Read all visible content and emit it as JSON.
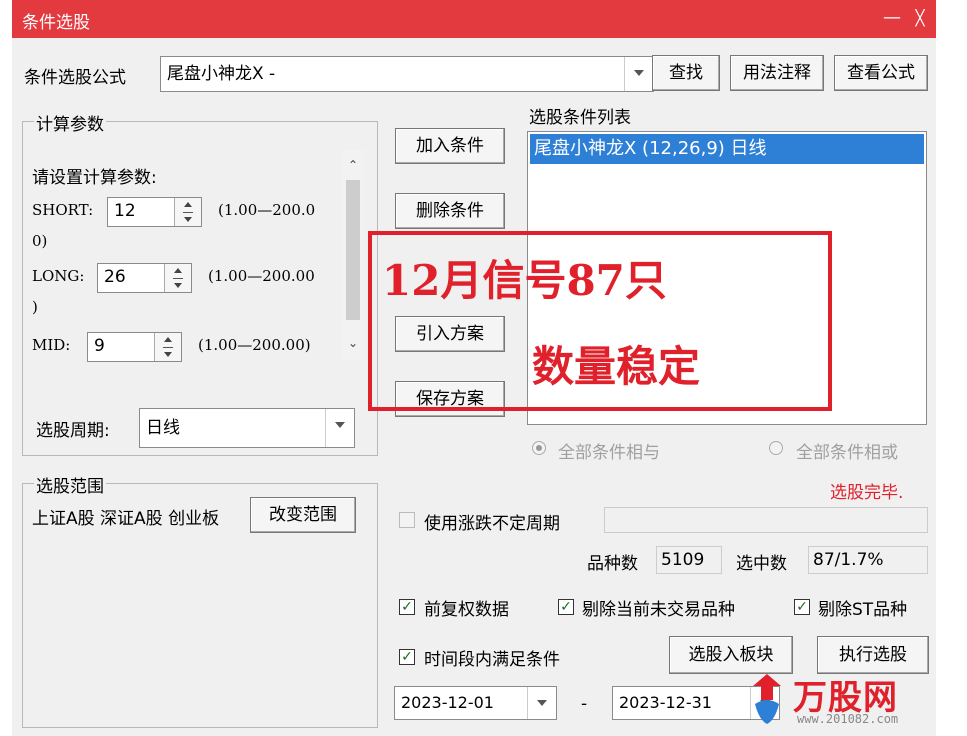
{
  "window": {
    "title": "条件选股",
    "minimize_symbol": "—",
    "close_symbol": "╳"
  },
  "formula": {
    "label": "条件选股公式",
    "value": "尾盘小神龙X  -",
    "find_button": "查找",
    "usage_button": "用法注释",
    "view_button": "查看公式"
  },
  "params": {
    "group_title": "计算参数",
    "prompt": "请设置计算参数:",
    "rows": [
      {
        "name": "SHORT:",
        "value": "12",
        "range": "(1.00—200.0",
        "range_cont": "0)"
      },
      {
        "name": "LONG:",
        "value": "26",
        "range": "(1.00—200.00",
        "range_cont": ")"
      },
      {
        "name": "MID:",
        "value": "9",
        "range": "(1.00—200.00)"
      }
    ],
    "period_label": "选股周期:",
    "period_value": "日线"
  },
  "scope": {
    "group_title": "选股范围",
    "text": "上证A股 深证A股 创业板",
    "change_button": "改变范围"
  },
  "actions": {
    "add": "加入条件",
    "delete": "删除条件",
    "import": "引入方案",
    "save": "保存方案"
  },
  "conditions": {
    "title": "选股条件列表",
    "items": [
      "尾盘小神龙X (12,26,9) 日线"
    ],
    "radio_and": "全部条件相与",
    "radio_or": "全部条件相或",
    "status": "选股完毕."
  },
  "overlay": {
    "line1": "12月信号87只",
    "line2": "数量稳定"
  },
  "options": {
    "variable_period": "使用涨跌不定周期",
    "variety_label": "品种数",
    "variety_count": "5109",
    "selected_label": "选中数",
    "selected_value": "87/1.7%",
    "fq": "前复权数据",
    "exclude_untraded": "剔除当前未交易品种",
    "exclude_st": "剔除ST品种",
    "time_range": "时间段内满足条件",
    "to_block_button": "选股入板块",
    "execute_button": "执行选股",
    "start_date": "2023-12-01",
    "date_sep": "-",
    "end_date": "2023-12-31"
  },
  "watermark": {
    "brand": "万股网",
    "url": "www.201082.com"
  },
  "colors": {
    "titlebar": "#e23a3f",
    "selection": "#2e7fd6",
    "annotation": "#e0202a"
  }
}
